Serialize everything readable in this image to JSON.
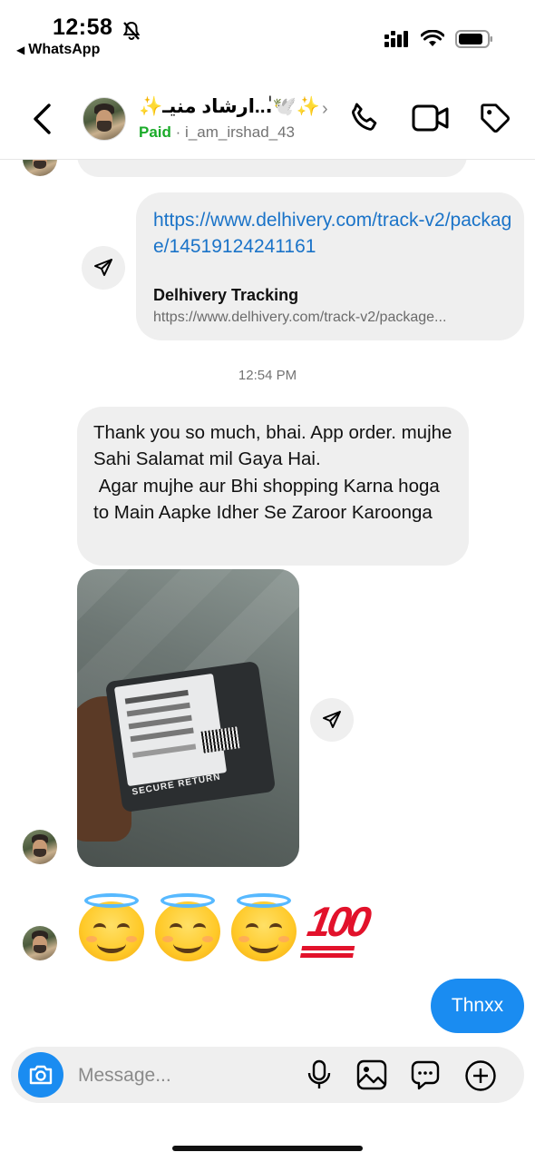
{
  "status_bar": {
    "time": "12:58",
    "back_app": "WhatsApp"
  },
  "header": {
    "display_name": "✨ارشاد منیـ...ٰ🕊️✨",
    "paid_label": "Paid",
    "separator": "·",
    "username": "i_am_irshad_43",
    "icons": [
      "back-chevron",
      "phone",
      "video-camera",
      "tag"
    ]
  },
  "chat": {
    "shared_link": {
      "url": "https://www.delhivery.com/track-v2/package/14519124241161",
      "title": "Delhivery Tracking",
      "preview_url": "https://www.delhivery.com/track-v2/package..."
    },
    "timestamp": "12:54 PM",
    "incoming_message": "Thank you so much, bhai. App order. mujhe Sahi Salamat mil Gaya Hai.\n Agar mujhe aur Bhi shopping Karna hoga to Main Aapke Idher Se Zaroor Karoonga",
    "photo_caption_text": "SECURE RETURN",
    "emoji_message": "😇😇😇💯",
    "outgoing_message": "Thnxx"
  },
  "composer": {
    "placeholder": "Message...",
    "icons": [
      "camera",
      "microphone",
      "gallery",
      "sticker-chat",
      "plus"
    ]
  },
  "colors": {
    "accent_blue": "#1a8cf1",
    "link_blue": "#1a73c8",
    "paid_green": "#1aab29",
    "bubble_gray": "#efefef"
  }
}
